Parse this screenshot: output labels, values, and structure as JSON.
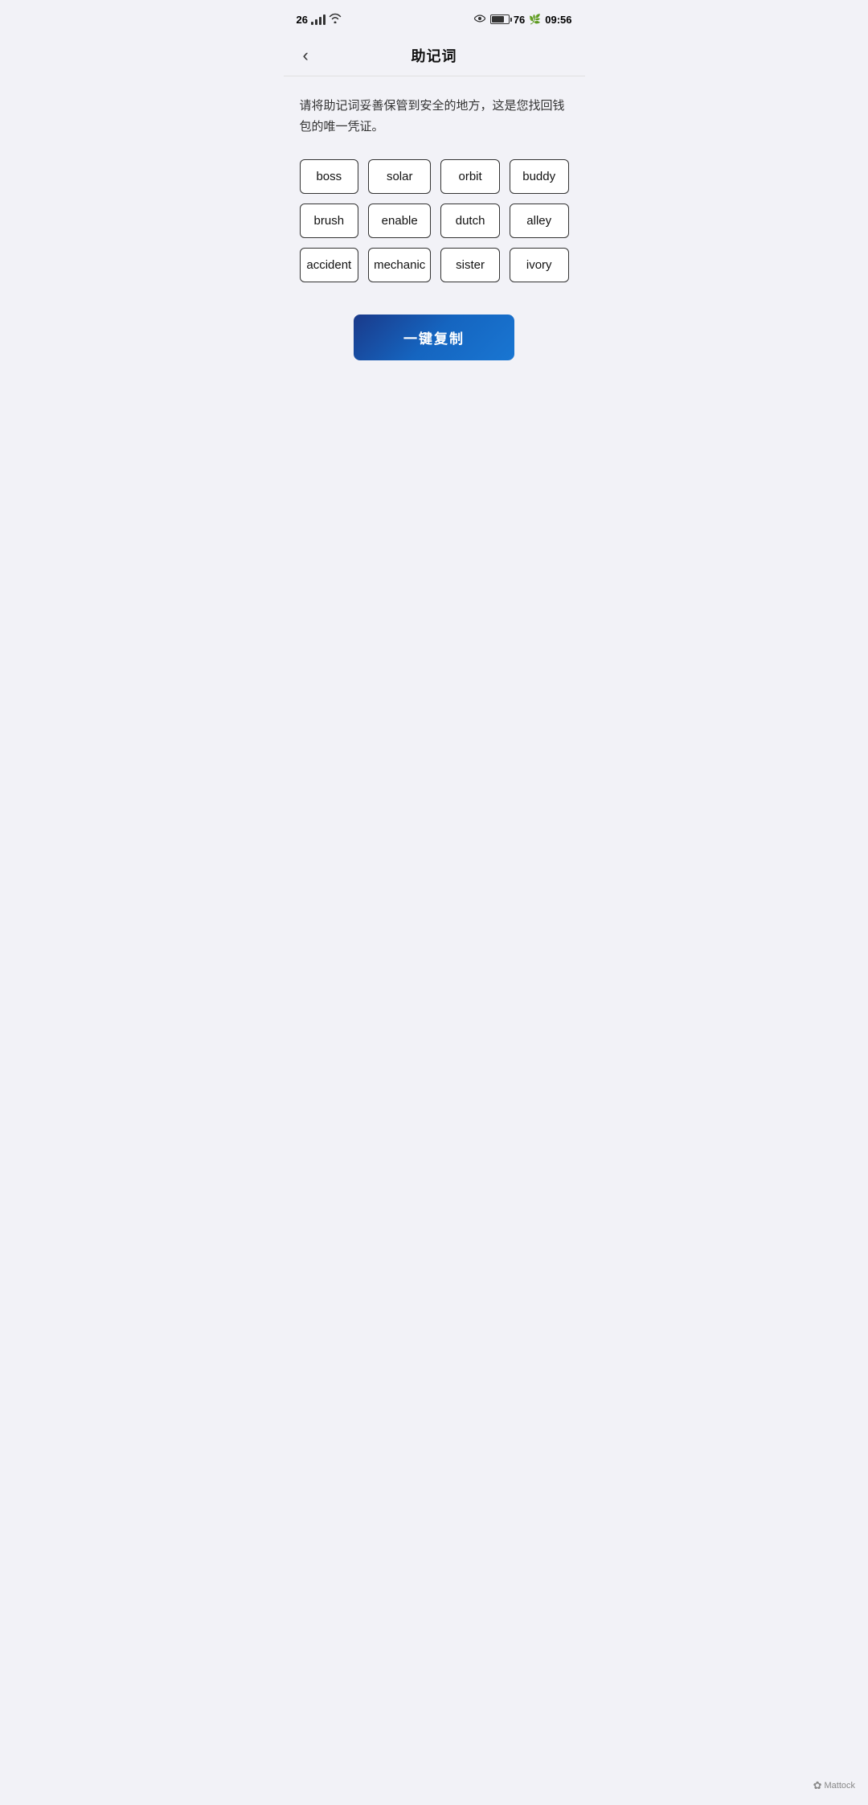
{
  "statusBar": {
    "signal": "26",
    "time": "09:56",
    "battery": "76"
  },
  "header": {
    "title": "助记词",
    "backLabel": "‹"
  },
  "description": "请将助记词妥善保管到安全的地方，这是您找回钱包的唯一凭证。",
  "mnemonicWords": [
    {
      "id": 1,
      "word": "boss"
    },
    {
      "id": 2,
      "word": "solar"
    },
    {
      "id": 3,
      "word": "orbit"
    },
    {
      "id": 4,
      "word": "buddy"
    },
    {
      "id": 5,
      "word": "brush"
    },
    {
      "id": 6,
      "word": "enable"
    },
    {
      "id": 7,
      "word": "dutch"
    },
    {
      "id": 8,
      "word": "alley"
    },
    {
      "id": 9,
      "word": "accident"
    },
    {
      "id": 10,
      "word": "mechanic"
    },
    {
      "id": 11,
      "word": "sister"
    },
    {
      "id": 12,
      "word": "ivory"
    }
  ],
  "copyButton": {
    "label": "一键复制"
  },
  "footer": {
    "brand": "Mattock"
  }
}
